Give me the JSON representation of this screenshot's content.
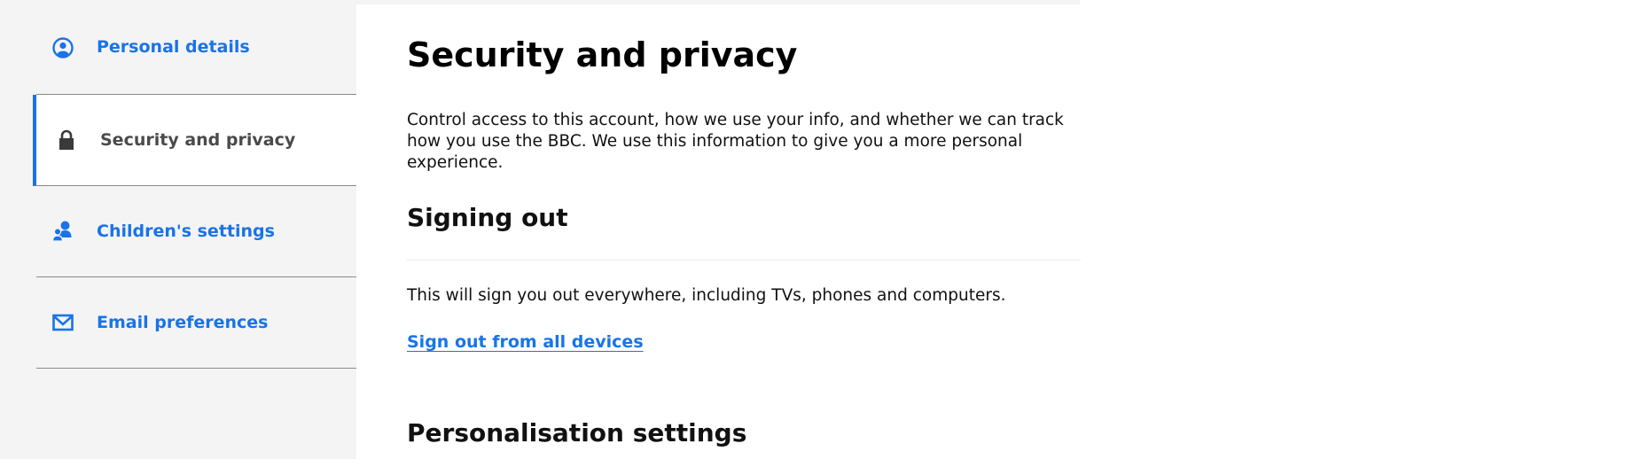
{
  "sidebar": {
    "items": [
      {
        "label": "Personal details",
        "icon": "user-circle-icon",
        "active": false
      },
      {
        "label": "Security and privacy",
        "icon": "lock-icon",
        "active": true
      },
      {
        "label": "Children's settings",
        "icon": "children-icon",
        "active": false
      },
      {
        "label": "Email preferences",
        "icon": "envelope-icon",
        "active": false
      }
    ]
  },
  "main": {
    "title": "Security and privacy",
    "intro": "Control access to this account, how we use your info, and whether we can track how you use the BBC. We use this information to give you a more personal experience.",
    "signing_out": {
      "heading": "Signing out",
      "description": "This will sign you out everywhere, including TVs, phones and computers.",
      "link_label": "Sign out from all devices"
    },
    "personalisation": {
      "heading": "Personalisation settings"
    }
  },
  "colors": {
    "accent": "#1a73e8",
    "sidebar_bg": "#f4f4f4",
    "active_label": "#4a4a4a"
  }
}
